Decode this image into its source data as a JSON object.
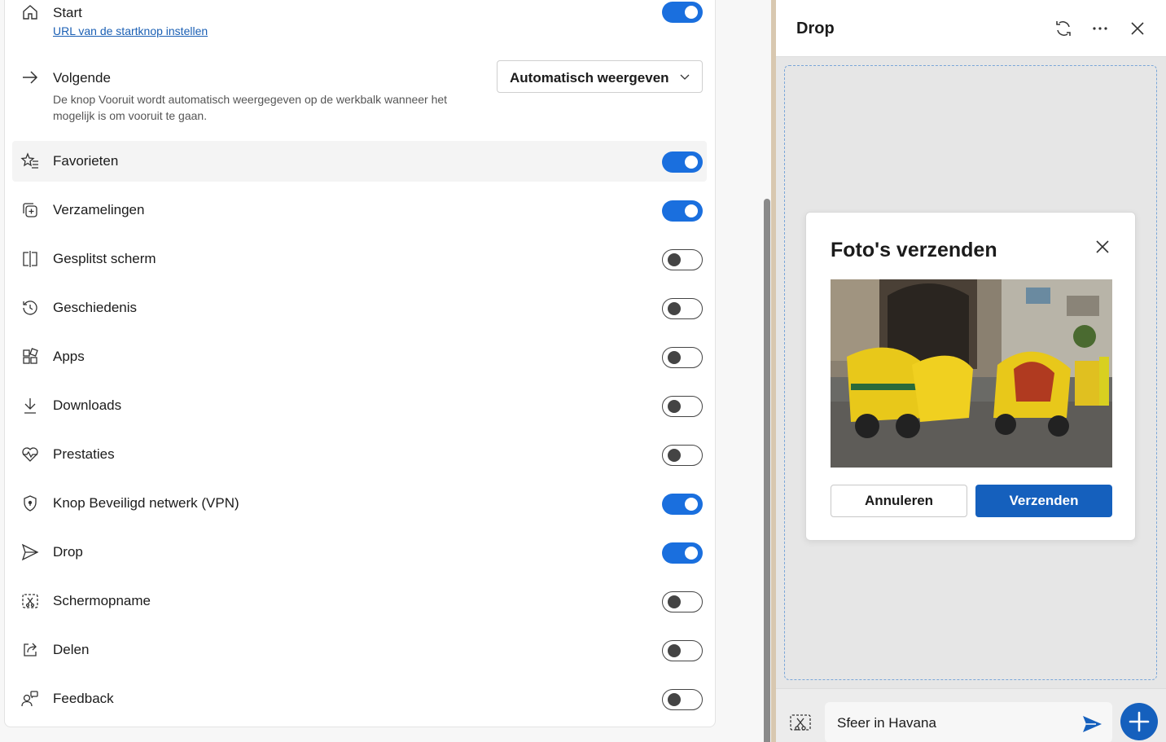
{
  "settings": {
    "start": {
      "label": "Start",
      "link": "URL van de startknop instellen",
      "on": true
    },
    "next": {
      "label": "Volgende",
      "description": "De knop Vooruit wordt automatisch weergegeven op de werkbalk wanneer het mogelijk is om vooruit te gaan.",
      "dropdown_value": "Automatisch weergeven"
    },
    "items": [
      {
        "label": "Favorieten",
        "icon": "favorites-icon",
        "on": true
      },
      {
        "label": "Verzamelingen",
        "icon": "collections-icon",
        "on": true
      },
      {
        "label": "Gesplitst scherm",
        "icon": "split-screen-icon",
        "on": false
      },
      {
        "label": "Geschiedenis",
        "icon": "history-icon",
        "on": false
      },
      {
        "label": "Apps",
        "icon": "apps-icon",
        "on": false
      },
      {
        "label": "Downloads",
        "icon": "download-icon",
        "on": false
      },
      {
        "label": "Prestaties",
        "icon": "performance-icon",
        "on": false
      },
      {
        "label": "Knop Beveiligd netwerk (VPN)",
        "icon": "shield-icon",
        "on": true
      },
      {
        "label": "Drop",
        "icon": "send-icon",
        "on": true
      },
      {
        "label": "Schermopname",
        "icon": "screenshot-icon",
        "on": false
      },
      {
        "label": "Delen",
        "icon": "share-icon",
        "on": false
      },
      {
        "label": "Feedback",
        "icon": "feedback-icon",
        "on": false
      }
    ]
  },
  "drop": {
    "title": "Drop",
    "dialog": {
      "title": "Foto's verzenden",
      "cancel": "Annuleren",
      "send": "Verzenden"
    },
    "message": "Sfeer in Havana"
  },
  "colors": {
    "accent": "#1560bd",
    "toggle_on": "#1a6fde"
  }
}
